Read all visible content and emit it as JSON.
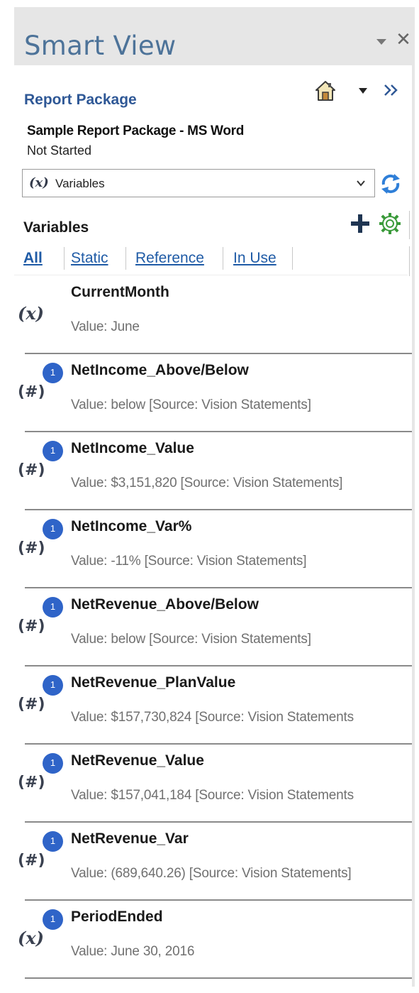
{
  "pane": {
    "title": "Smart View",
    "menu_icon": "dropdown-caret",
    "close_glyph": "✕"
  },
  "report_package": {
    "section_title": "Report Package",
    "doc_name": "Sample Report Package - MS Word",
    "status": "Not Started"
  },
  "selector": {
    "icon_text": "(x)",
    "value": "Variables"
  },
  "variables_panel": {
    "header": "Variables",
    "filters": [
      {
        "label": "All",
        "active": true
      },
      {
        "label": "Static",
        "active": false
      },
      {
        "label": "Reference",
        "active": false
      },
      {
        "label": "In Use",
        "active": false
      }
    ]
  },
  "variables": [
    {
      "name": "CurrentMonth",
      "value": "Value: June",
      "type_icon": "(x)",
      "type": "static",
      "badge": ""
    },
    {
      "name": "NetIncome_Above/Below",
      "value": "Value: below [Source: Vision Statements]",
      "type_icon": "(#)",
      "type": "reference",
      "badge": "1"
    },
    {
      "name": "NetIncome_Value",
      "value": "Value:  $3,151,820  [Source: Vision Statements]",
      "type_icon": "(#)",
      "type": "reference",
      "badge": "1"
    },
    {
      "name": "NetIncome_Var%",
      "value": "Value: -11% [Source: Vision Statements]",
      "type_icon": "(#)",
      "type": "reference",
      "badge": "1"
    },
    {
      "name": "NetRevenue_Above/Below",
      "value": "Value: below [Source: Vision Statements]",
      "type_icon": "(#)",
      "type": "reference",
      "badge": "1"
    },
    {
      "name": "NetRevenue_PlanValue",
      "value": "Value:  $157,730,824  [Source: Vision Statements",
      "type_icon": "(#)",
      "type": "reference",
      "badge": "1"
    },
    {
      "name": "NetRevenue_Value",
      "value": "Value:  $157,041,184  [Source: Vision Statements",
      "type_icon": "(#)",
      "type": "reference",
      "badge": "1"
    },
    {
      "name": "NetRevenue_Var",
      "value": "Value:  (689,640.26) [Source: Vision Statements]",
      "type_icon": "(#)",
      "type": "reference",
      "badge": "1"
    },
    {
      "name": "PeriodEnded",
      "value": "Value: June 30, 2016",
      "type_icon": "(x)",
      "type": "static",
      "badge": "1"
    }
  ],
  "colors": {
    "title": "#4d7399",
    "link": "#1f5ba6",
    "badge": "#2f64c8",
    "accent_green": "#3a9a3a"
  }
}
